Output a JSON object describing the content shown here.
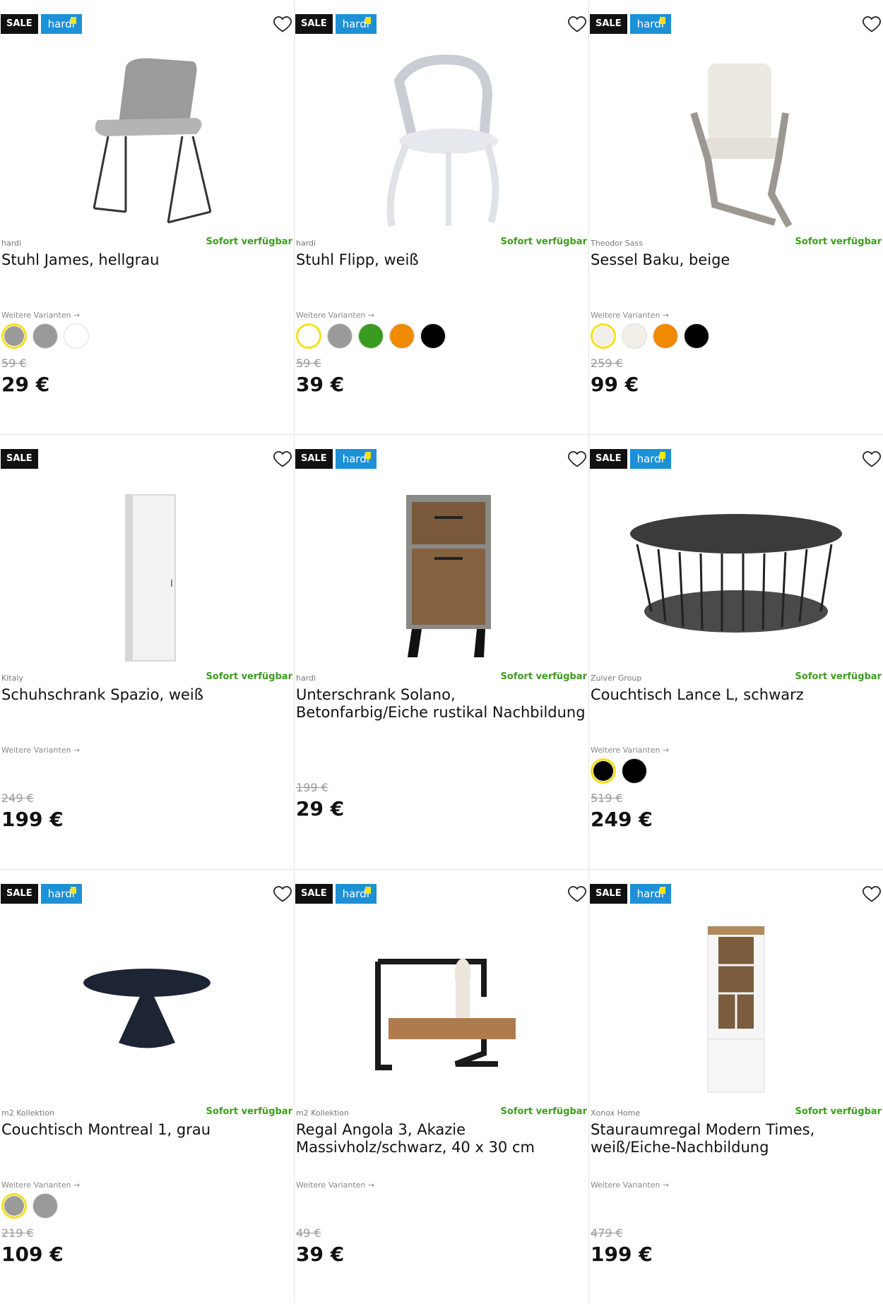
{
  "labels": {
    "sale": "SALE",
    "hardi": "hardi",
    "variants": "Weitere Varianten →",
    "available": "Sofort verfügbar"
  },
  "products": [
    {
      "brand": "hardi",
      "title": "Stuhl James, hellgrau",
      "old_price": "59 €",
      "price": "29 €",
      "swatches": [
        "#9a9a9a",
        "#9a9a9a",
        "#ffffff"
      ]
    },
    {
      "brand": "hardi",
      "title": "Stuhl Flipp, weiß",
      "old_price": "59 €",
      "price": "39 €",
      "swatches": [
        "#ffffff",
        "#9a9a9a",
        "#3a9b21",
        "#f08a00",
        "#000000"
      ]
    },
    {
      "brand": "Theodor Sass",
      "title": "Sessel Baku, beige",
      "old_price": "259 €",
      "price": "99 €",
      "swatches": [
        "#f1efe8",
        "#f1efe8",
        "#f08a00",
        "#000000"
      ]
    },
    {
      "brand": "Kitaly",
      "title": "Schuhschrank Spazio, weiß",
      "old_price": "249 €",
      "price": "199 €",
      "swatches": []
    },
    {
      "brand": "hardi",
      "title": "Unterschrank Solano, Betonfarbig/Eiche rustikal Nachbildung",
      "old_price": "199 €",
      "price": "29 €",
      "swatches": []
    },
    {
      "brand": "Zuiver Group",
      "title": "Couchtisch Lance L, schwarz",
      "old_price": "519 €",
      "price": "249 €",
      "swatches": [
        "#000000",
        "#000000"
      ]
    },
    {
      "brand": "m2 Kollektion",
      "title": "Couchtisch Montreal 1, grau",
      "old_price": "219 €",
      "price": "109 €",
      "swatches": [
        "#9a9a9a",
        "#9a9a9a"
      ]
    },
    {
      "brand": "m2 Kollektion",
      "title": "Regal Angola 3, Akazie Massivholz/schwarz, 40 x 30 cm",
      "old_price": "49 €",
      "price": "39 €",
      "swatches": []
    },
    {
      "brand": "Xonox Home",
      "title": "Stauraumregal Modern Times, weiß/Eiche-Nachbildung",
      "old_price": "479 €",
      "price": "199 €",
      "swatches": []
    }
  ]
}
